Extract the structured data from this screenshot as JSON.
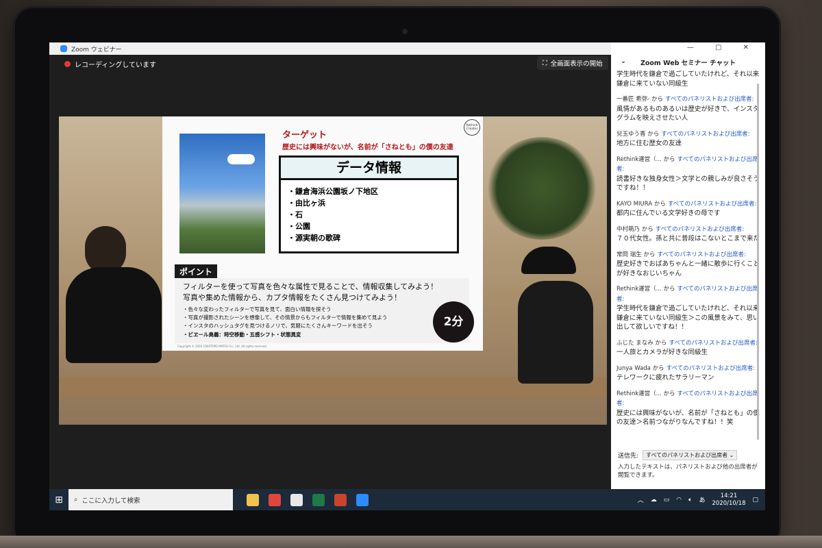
{
  "window": {
    "title": "Zoom ウェビナー"
  },
  "recording": {
    "label": "レコーディングしています"
  },
  "fullscreen": {
    "label": "全画面表示の開始"
  },
  "slide": {
    "target_title": "ターゲット",
    "target_text": "歴史には興味がないが、名前が「さねとも」の僕の友達",
    "logo_text": "Rethink Creator",
    "data_header": "データ情報",
    "data_items": [
      "鎌倉海浜公園坂ノ下地区",
      "由比ヶ浜",
      "石",
      "公園",
      "源実朝の歌碑"
    ],
    "point_label": "ポイント",
    "point_main": [
      "フィルターを使って写真を色々な属性で見ることで、情報収集してみよう！",
      "写真や集めた情報から、カプタ情報をたくさん見つけてみよう！"
    ],
    "point_sub": [
      "・色々な変わったフィルターで写真を見て、面白い情報を探そう",
      "・写真が撮影されたシーンを想像して、その情景からもフィルターで情報を集めて見よう",
      "・インスタのハッシュタグを見つけるノリで、気軽にたくさんキーワードを出そう",
      "・ビヱール奥義：時空移動・五感シフト・状態異変"
    ],
    "timer": "2分",
    "copyright": "Copyright © 2020 CREATORS MATCH Co., Ltd. All rights reserved."
  },
  "chat": {
    "title": "Zoom Web セミナー チャット",
    "window_controls": "— ▢ ✕",
    "messages": [
      {
        "from": "",
        "to": "",
        "text": "学生時代を鎌倉で過ごしていたけれど、それ以来鎌倉に来ていない同級生"
      },
      {
        "from": "一番匠 希弥- から",
        "to": "すべてのパネリストおよび出席者:",
        "text": "風情があるものあるいは歴史が好きで、インスタグラムを映えさせたい人"
      },
      {
        "from": "兒玉ゆう香 から",
        "to": "すべてのパネリストおよび出席者:",
        "text": "地方に住む歴女の友達"
      },
      {
        "from": "Rethink運営（... から",
        "to": "すべてのパネリストおよび出席者:",
        "text": "読書好きな独身女性＞文学との親しみが良さそうですね！！"
      },
      {
        "from": "KAYO MIURA から",
        "to": "すべてのパネリストおよび出席者:",
        "text": "都内に住んでいる文学好きの母です"
      },
      {
        "from": "中村萌乃 から",
        "to": "すべてのパネリストおよび出席者:",
        "text": "７０代女性。孫と共に普段はこないとこまで来た"
      },
      {
        "from": "常岡 瑞生 から",
        "to": "すべてのパネリストおよび出席者:",
        "text": "歴史好きでおばあちゃんと一緒に散歩に行くことが好きなおじいちゃん"
      },
      {
        "from": "Rethink運営（... から",
        "to": "すべてのパネリストおよび出席者:",
        "text": "学生時代を鎌倉で過ごしていたけれど、それ以来鎌倉に来ていない同級生＞この風景をみて、思い出して欲しいですね！！"
      },
      {
        "from": "ふじた まなみ から",
        "to": "すべてのパネリストおよび出席者:",
        "text": "一人旅とカメラが好きな同級生"
      },
      {
        "from": "Junya Wada から",
        "to": "すべてのパネリストおよび出席者:",
        "text": "テレワークに疲れたサラリーマン"
      },
      {
        "from": "Rethink運営（... から",
        "to": "すべてのパネリストおよび出席者:",
        "text": "歴史には興味がないが、名前が「さねとも」の僕の友達＞名前つながりなんですね！！笑"
      }
    ],
    "send_label": "送信先:",
    "send_target": "すべてのパネリストおよび出席者 ⌄",
    "note": "入力したテキストは、パネリストおよび他の出席者が閲覧できます。"
  },
  "taskbar": {
    "search_placeholder": "ここに入力して検索",
    "time": "14:21",
    "date": "2020/10/18",
    "ime": "あ",
    "apps": [
      {
        "name": "file-explorer",
        "color": "#f2c14e"
      },
      {
        "name": "chrome",
        "color": "#e0463c"
      },
      {
        "name": "slack",
        "color": "#e8e8e8"
      },
      {
        "name": "excel",
        "color": "#1f7a45"
      },
      {
        "name": "powerpoint",
        "color": "#c9442b"
      },
      {
        "name": "zoom",
        "color": "#2d8cff"
      }
    ]
  }
}
